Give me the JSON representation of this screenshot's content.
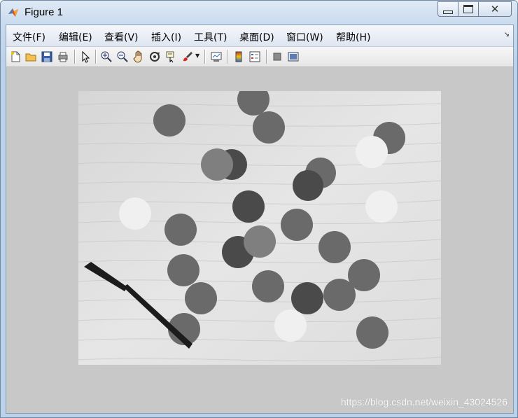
{
  "window": {
    "title": "Figure 1"
  },
  "menu": {
    "items": [
      {
        "label": "文件(F)"
      },
      {
        "label": "编辑(E)"
      },
      {
        "label": "查看(V)"
      },
      {
        "label": "插入(I)"
      },
      {
        "label": "工具(T)"
      },
      {
        "label": "桌面(D)"
      },
      {
        "label": "窗口(W)"
      },
      {
        "label": "帮助(H)"
      }
    ]
  },
  "toolbar": {
    "buttons": [
      "new-figure-icon",
      "open-file-icon",
      "save-icon",
      "print-icon",
      "edit-pointer-icon",
      "zoom-in-icon",
      "zoom-out-icon",
      "pan-hand-icon",
      "rotate-3d-icon",
      "data-cursor-icon",
      "brush-icon",
      "brush-dropdown-icon",
      "link-plot-icon",
      "colorbar-icon",
      "legend-icon",
      "hide-plot-tools-icon",
      "show-plot-tools-icon"
    ]
  },
  "image": {
    "description_type": "grayscale photo of coins and a pen on wood"
  },
  "watermark": {
    "text": "https://blog.csdn.net/weixin_43024526"
  },
  "colors": {
    "client_bg": "#c8c8c8",
    "titlebar": "#c9dbee"
  }
}
